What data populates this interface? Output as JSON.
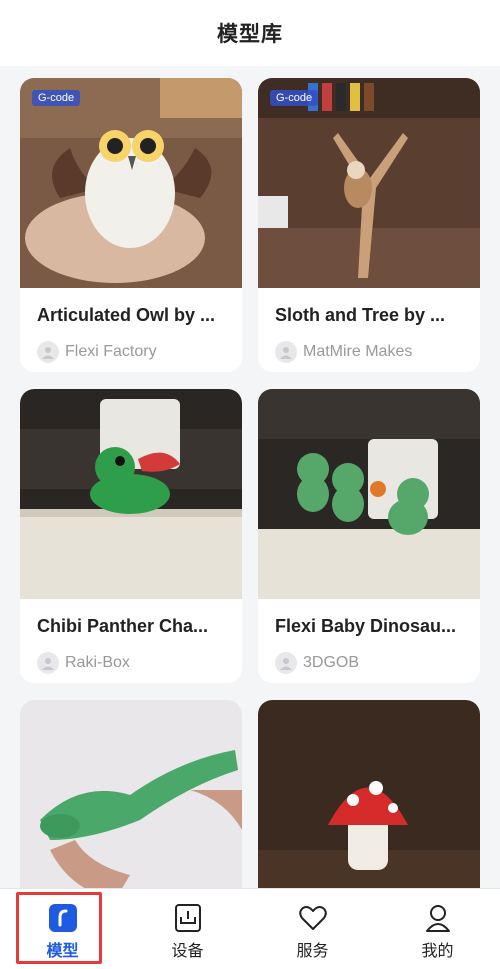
{
  "header": {
    "title": "模型库"
  },
  "models": [
    {
      "title": "Articulated Owl by ...",
      "author": "Flexi Factory",
      "tag": "G-code"
    },
    {
      "title": "Sloth and Tree by ...",
      "author": "MatMire Makes",
      "tag": "G-code"
    },
    {
      "title": "Chibi Panther Cha...",
      "author": "Raki-Box"
    },
    {
      "title": "Flexi Baby Dinosau...",
      "author": "3DGOB"
    },
    {
      "title": "",
      "author": ""
    },
    {
      "title": "",
      "author": ""
    }
  ],
  "tabs": [
    {
      "label": "模型",
      "icon": "model-icon",
      "active": true
    },
    {
      "label": "设备",
      "icon": "device-icon",
      "active": false
    },
    {
      "label": "服务",
      "icon": "heart-icon",
      "active": false
    },
    {
      "label": "我的",
      "icon": "profile-icon",
      "active": false
    }
  ],
  "colors": {
    "accent": "#1f5be0",
    "highlight": "#e63b3b"
  }
}
